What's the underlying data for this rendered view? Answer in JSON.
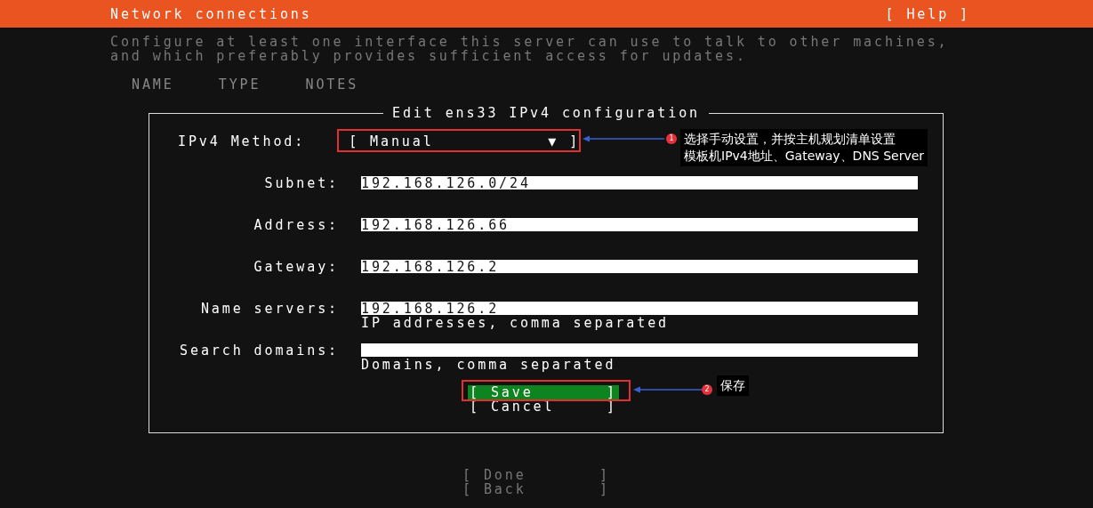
{
  "header": {
    "title": "Network connections",
    "help": "[ Help ]"
  },
  "intro": [
    "Configure at least one interface this server can use to talk to other machines,",
    "and which preferably provides sufficient access for updates."
  ],
  "table": {
    "columns": [
      "NAME",
      "TYPE",
      "NOTES"
    ]
  },
  "dialog": {
    "title": "Edit ens33 IPv4 configuration",
    "method": {
      "label": "IPv4 Method:",
      "open": "[",
      "value": "Manual",
      "arrow": "▼",
      "close": "]"
    },
    "fields": [
      {
        "label": "Subnet:",
        "value": "192.168.126.0/24"
      },
      {
        "label": "Address:",
        "value": "192.168.126.66"
      },
      {
        "label": "Gateway:",
        "value": "192.168.126.2"
      },
      {
        "label": "Name servers:",
        "value": "192.168.126.2",
        "hint": "IP addresses, comma separated"
      },
      {
        "label": "Search domains:",
        "hint": "Domains, comma separated"
      }
    ],
    "buttons": [
      {
        "open": "[",
        "label": "Save",
        "close": "]",
        "selected": true
      },
      {
        "open": "[",
        "label": "Cancel",
        "close": "]",
        "selected": false
      }
    ]
  },
  "footer_buttons": [
    {
      "open": "[",
      "label": "Done",
      "close": "]"
    },
    {
      "open": "[",
      "label": "Back",
      "close": "]"
    }
  ],
  "annotations": [
    {
      "number": "1",
      "lines": [
        "选择手动设置，并按主机规划清单设置",
        "模板机IPv4地址、Gateway、DNS Server"
      ]
    },
    {
      "number": "2",
      "lines": [
        "保存"
      ]
    }
  ]
}
